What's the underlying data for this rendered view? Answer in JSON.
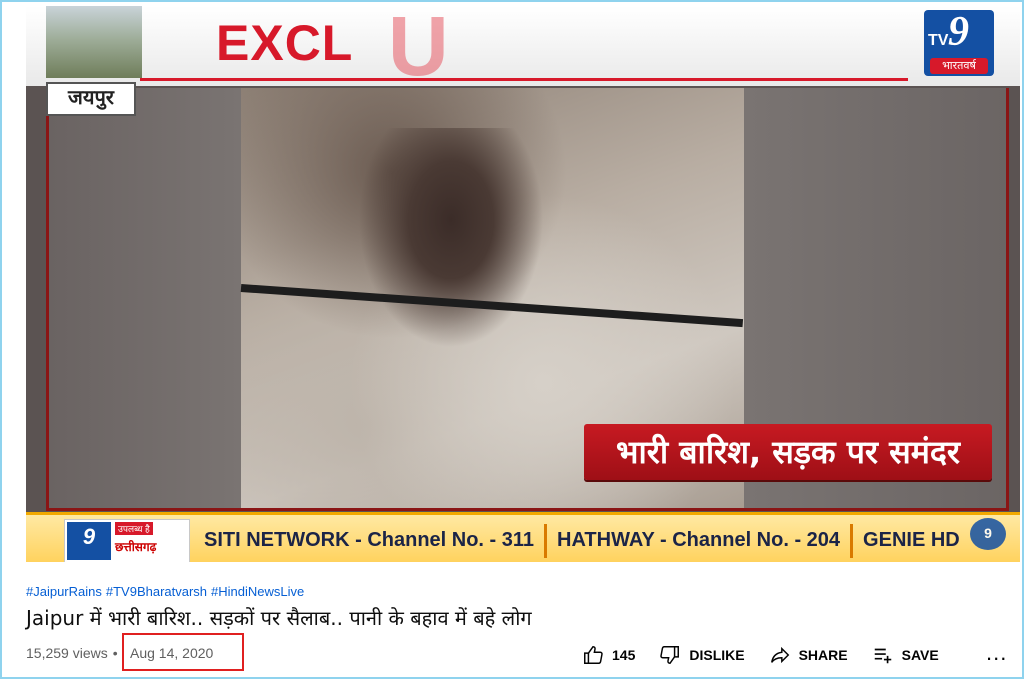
{
  "video": {
    "banner_text": "EXCL",
    "banner_overlay_letter": "U",
    "channel_logo": {
      "number": "9",
      "tv": "TV",
      "brand": "भारतवर्ष"
    },
    "city_label": "जयपुर",
    "headline": "भारी बारिश, सड़क पर समंदर",
    "ticker": {
      "logo_number": "9",
      "logo_tag": "उपलब्ध है",
      "logo_region": "छत्तीसगढ़",
      "items": [
        "SITI NETWORK - Channel No. - 311",
        "HATHWAY - Channel No. - 204",
        "GENIE HD"
      ]
    },
    "corner_mark": "9"
  },
  "hashtags": [
    "#JaipurRains",
    "#TV9Bharatvarsh",
    "#HindiNewsLive"
  ],
  "title": "Jaipur में भारी बारिश.. सड़कों पर सैलाब.. पानी के बहाव में बहे लोग",
  "views": "15,259 views",
  "date": "Aug 14, 2020",
  "actions": {
    "like_count": "145",
    "dislike_label": "DISLIKE",
    "share_label": "SHARE",
    "save_label": "SAVE",
    "more_label": "..."
  },
  "colors": {
    "accent_red": "#d7192a",
    "link_blue": "#065fd4",
    "highlight_border": "#e02020"
  }
}
